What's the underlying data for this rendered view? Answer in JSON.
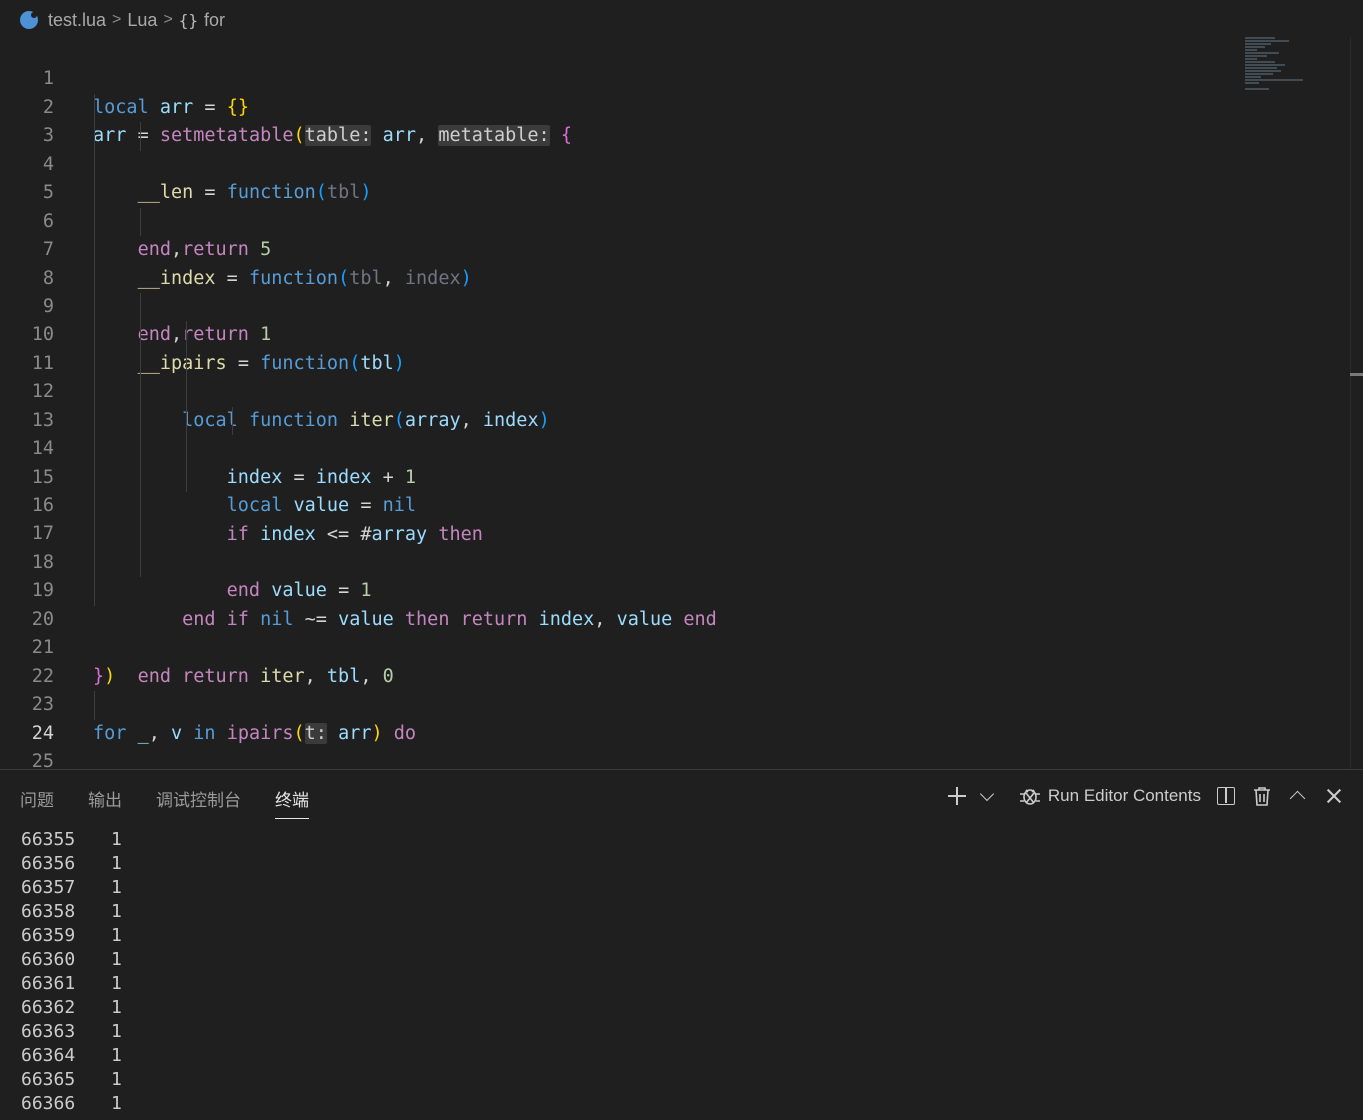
{
  "breadcrumb": {
    "file": "test.lua",
    "language": "Lua",
    "symbol_icon": "{}",
    "symbol": "for",
    "separator": ">"
  },
  "editor": {
    "line_numbers": [
      "1",
      "2",
      "3",
      "4",
      "5",
      "6",
      "7",
      "8",
      "9",
      "10",
      "11",
      "12",
      "13",
      "14",
      "15",
      "16",
      "17",
      "18",
      "19",
      "20",
      "21",
      "22",
      "23",
      "24",
      "25"
    ],
    "active_line": "24"
  },
  "panel": {
    "tabs": [
      "问题",
      "输出",
      "调试控制台",
      "终端"
    ],
    "active_tab": "终端",
    "run_label": "Run Editor Contents"
  },
  "terminal": {
    "rows": [
      [
        "66355",
        "1"
      ],
      [
        "66356",
        "1"
      ],
      [
        "66357",
        "1"
      ],
      [
        "66358",
        "1"
      ],
      [
        "66359",
        "1"
      ],
      [
        "66360",
        "1"
      ],
      [
        "66361",
        "1"
      ],
      [
        "66362",
        "1"
      ],
      [
        "66363",
        "1"
      ],
      [
        "66364",
        "1"
      ],
      [
        "66365",
        "1"
      ],
      [
        "66366",
        "1"
      ]
    ]
  },
  "colors": {
    "background": "#1f1f1f",
    "keyword_blue": "#569cd6",
    "control_purple": "#c586c0",
    "function_yellow": "#dcdcaa",
    "variable_lightblue": "#9cdcfe",
    "number_green": "#b5cea8",
    "selection": "#264f78"
  }
}
